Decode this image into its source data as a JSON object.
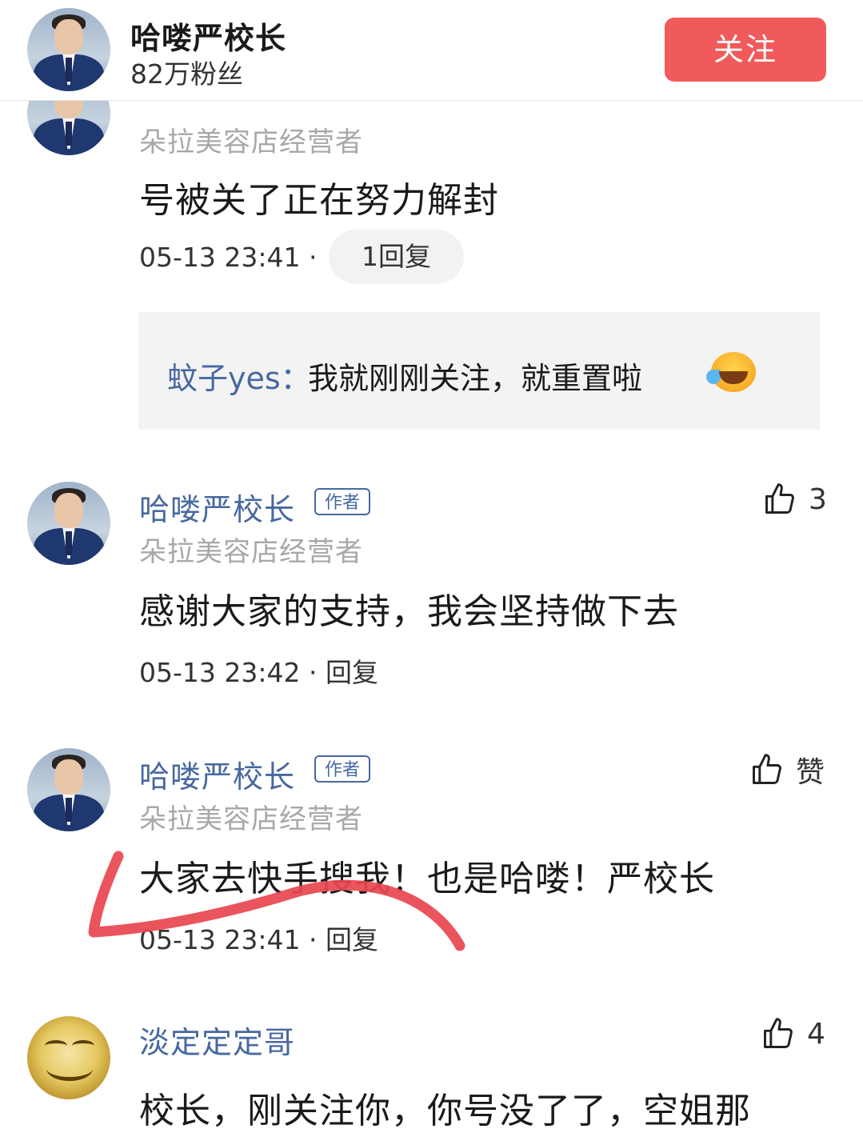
{
  "header": {
    "name": "哈喽严校长",
    "fans": "82万粉丝",
    "follow_label": "关注"
  },
  "comments": [
    {
      "subtitle": "朵拉美容店经营者",
      "content": "号被关了正在努力解封",
      "time": "05-13 23:41",
      "reply_label": "1回复",
      "sub_reply": {
        "user": "蚊子yes",
        "sep": "：",
        "text": "我就刚刚关注，就重置啦"
      }
    },
    {
      "name": "哈喽严校长",
      "badge": "作者",
      "subtitle": "朵拉美容店经营者",
      "content": "感谢大家的支持，我会坚持做下去",
      "time": "05-13 23:42",
      "reply_label": "回复",
      "likes": "3"
    },
    {
      "name": "哈喽严校长",
      "badge": "作者",
      "subtitle": "朵拉美容店经营者",
      "content": "大家去快手搜我！也是哈喽！严校长",
      "time": "05-13 23:41",
      "reply_label": "回复",
      "likes": "赞"
    },
    {
      "name": "淡定定定哥",
      "content": "校长，刚关注你，你号没了了，空姐那",
      "likes": "4"
    }
  ],
  "separator": "·",
  "colors": {
    "accent": "#f05a5a",
    "link": "#4868a0",
    "annotation": "#e8454f"
  },
  "icons": [
    "thumb-up-icon",
    "laughing-tears-emoji"
  ]
}
